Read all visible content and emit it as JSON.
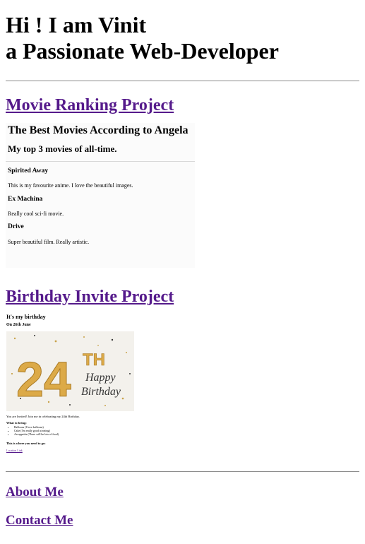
{
  "hero": {
    "line1": "Hi ! I am Vinit",
    "line2": "a Passionate Web-Developer"
  },
  "movie_project": {
    "title": "Movie Ranking Project",
    "preview": {
      "heading": "The Best Movies According to Angela",
      "subheading": "My top 3 movies of all-time.",
      "movies": [
        {
          "name": "Spirited Away",
          "desc": "This is my favourite anime. I love the beautiful images."
        },
        {
          "name": "Ex Machina",
          "desc": "Really cool sci-fi movie."
        },
        {
          "name": "Drive",
          "desc": "Super beautiful film. Really artistic."
        }
      ]
    }
  },
  "birthday_project": {
    "title": "Birthday Invite Project",
    "preview": {
      "heading": "It's my birthday",
      "date": "On 26th June",
      "image_number": "24",
      "image_th": "TH",
      "image_script_1": "Happy",
      "image_script_2": "Birthday",
      "invite_text": "You are Invited! Join me in celebrating my 24th Birthday.",
      "bring_label": "What to bring:",
      "bring_items": [
        "Balloons (I love balloons)",
        "Cake (I'm really good at eating)",
        "An appetite (There will be lots of food)"
      ],
      "where_label": "This is where you need to go:",
      "location_link": "Location Link"
    }
  },
  "nav": {
    "about": "About Me",
    "contact": "Contact Me"
  },
  "colors": {
    "link": "#551a8b",
    "rule": "#8a8a8a",
    "balloon_gold": "#d9a441"
  }
}
